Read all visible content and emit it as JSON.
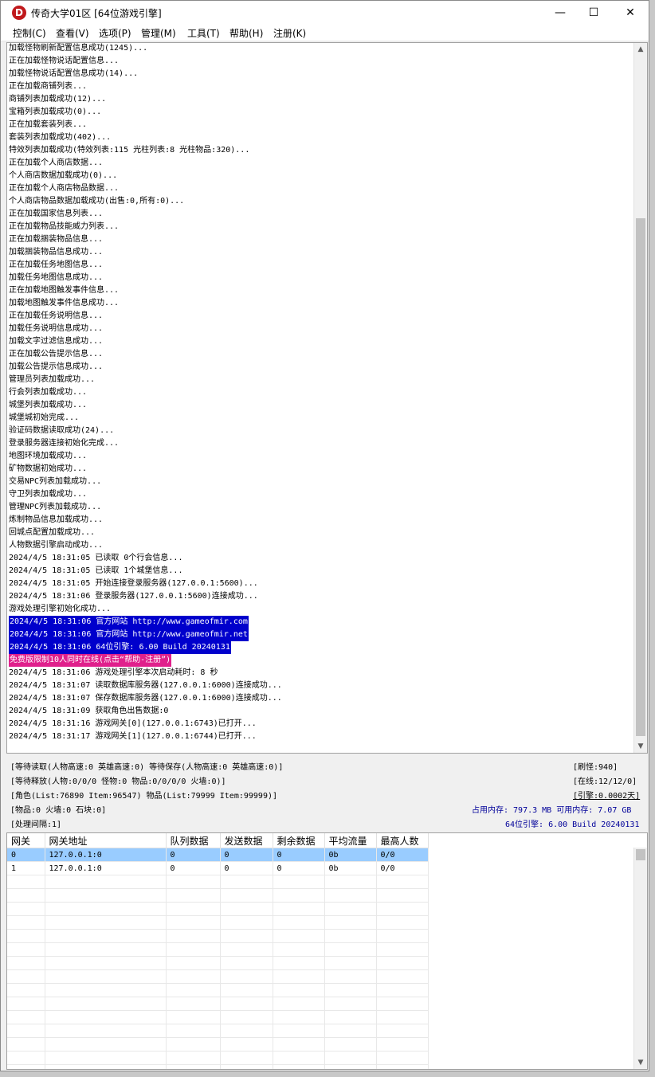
{
  "window": {
    "title": "传奇大学01区 [64位游戏引擎]",
    "icon_letter": "D",
    "minimize_glyph": "—",
    "maximize_glyph": "☐",
    "close_glyph": "✕"
  },
  "menu": [
    "控制(C)",
    "查看(V)",
    "选项(P)",
    "管理(M)",
    "工具(T)",
    "帮助(H)",
    "注册(K)"
  ],
  "colors": {
    "highlight_blue": "#0000cc",
    "highlight_pink": "#e0208c",
    "selected_row": "#99ccff",
    "status_blue": "#000099"
  },
  "log": [
    {
      "text": "加载怪物刷新配置信息成功(1245)..."
    },
    {
      "text": "正在加载怪物说话配置信息..."
    },
    {
      "text": "加载怪物说话配置信息成功(14)..."
    },
    {
      "text": "正在加载商铺列表..."
    },
    {
      "text": "商铺列表加载成功(12)..."
    },
    {
      "text": "宝箱列表加载成功(0)..."
    },
    {
      "text": "正在加载套装列表..."
    },
    {
      "text": "套装列表加载成功(402)..."
    },
    {
      "text": "特效列表加载成功(特效列表:115 光柱列表:8 光柱物品:320)..."
    },
    {
      "text": "正在加载个人商店数据..."
    },
    {
      "text": "个人商店数据加载成功(0)..."
    },
    {
      "text": "正在加载个人商店物品数据..."
    },
    {
      "text": "个人商店物品数据加载成功(出售:0,所有:0)..."
    },
    {
      "text": "正在加载国家信息列表..."
    },
    {
      "text": "正在加载物品技能威力列表..."
    },
    {
      "text": "正在加载捆装物品信息..."
    },
    {
      "text": "加载捆装物品信息成功..."
    },
    {
      "text": "正在加载任务地图信息..."
    },
    {
      "text": "加载任务地图信息成功..."
    },
    {
      "text": "正在加载地图触发事件信息..."
    },
    {
      "text": "加载地图触发事件信息成功..."
    },
    {
      "text": "正在加载任务说明信息..."
    },
    {
      "text": "加载任务说明信息成功..."
    },
    {
      "text": "加载文字过滤信息成功..."
    },
    {
      "text": "正在加载公告提示信息..."
    },
    {
      "text": "加载公告提示信息成功..."
    },
    {
      "text": "管理员列表加载成功..."
    },
    {
      "text": "行会列表加载成功..."
    },
    {
      "text": "城堡列表加载成功..."
    },
    {
      "text": "城堡城初始完成..."
    },
    {
      "text": "验证码数据读取成功(24)..."
    },
    {
      "text": "登录服务器连接初始化完成..."
    },
    {
      "text": "地图环境加载成功..."
    },
    {
      "text": "矿物数据初始成功..."
    },
    {
      "text": "交易NPC列表加载成功..."
    },
    {
      "text": "守卫列表加载成功..."
    },
    {
      "text": "管理NPC列表加载成功..."
    },
    {
      "text": "炼制物品信息加载成功..."
    },
    {
      "text": "回城点配置加载成功..."
    },
    {
      "text": "人物数据引擎启动成功..."
    },
    {
      "text": "2024/4/5 18:31:05 已读取 0个行会信息..."
    },
    {
      "text": "2024/4/5 18:31:05 已读取 1个城堡信息..."
    },
    {
      "text": "2024/4/5 18:31:05 开始连接登录服务器(127.0.0.1:5600)..."
    },
    {
      "text": "2024/4/5 18:31:06 登录服务器(127.0.0.1:5600)连接成功..."
    },
    {
      "text": "游戏处理引擎初始化成功..."
    },
    {
      "text": "2024/4/5 18:31:06 官方网站 http://www.gameofmir.com",
      "hl": "blue"
    },
    {
      "text": "2024/4/5 18:31:06 官方网站 http://www.gameofmir.net",
      "hl": "blue"
    },
    {
      "text": "2024/4/5 18:31:06 64位引擎: 6.00 Build 20240131",
      "hl": "blue"
    },
    {
      "text": "免费版限制10人同时在线(点击“帮助-注册”)",
      "hl": "pink"
    },
    {
      "text": "2024/4/5 18:31:06 游戏处理引擎本次启动耗时: 8 秒"
    },
    {
      "text": "2024/4/5 18:31:07 读取数据库服务器(127.0.0.1:6000)连接成功..."
    },
    {
      "text": "2024/4/5 18:31:07 保存数据库服务器(127.0.0.1:6000)连接成功..."
    },
    {
      "text": "2024/4/5 18:31:09 获取角色出售数据:0"
    },
    {
      "text": "2024/4/5 18:31:16 游戏网关[0](127.0.0.1:6743)已打开..."
    },
    {
      "text": "2024/4/5 18:31:17 游戏网关[1](127.0.0.1:6744)已打开..."
    }
  ],
  "status": {
    "line1": "[等待读取(人物高速:0 英雄高速:0) 等待保存(人物高速:0 英雄高速:0)]",
    "line2": "[等待释放(人物:0/0/0 怪物:0 物品:0/0/0/0 火墙:0)]",
    "line3": "[角色(List:76890 Item:96547) 物品(List:79999 Item:99999)]",
    "line4": "[物品:0 火墙:0 石块:0]",
    "line5": "[处理间隔:1]",
    "refresh_monsters": "[刷怪:940]",
    "online": "[在线:12/12/0]",
    "engine_days": "[引擎:0.0002天]",
    "memory": "占用内存: 797.3 MB 可用内存: 7.07 GB",
    "build": "64位引擎: 6.00 Build 20240131"
  },
  "gateway_table": {
    "columns": [
      "网关",
      "网关地址",
      "队列数据",
      "发送数据",
      "剩余数据",
      "平均流量",
      "最高人数"
    ],
    "rows": [
      [
        "0",
        "127.0.0.1:0",
        "0",
        "0",
        "0",
        "0b",
        "0/0"
      ],
      [
        "1",
        "127.0.0.1:0",
        "0",
        "0",
        "0",
        "0b",
        "0/0"
      ]
    ]
  },
  "scroll": {
    "up": "▲",
    "down": "▼"
  }
}
